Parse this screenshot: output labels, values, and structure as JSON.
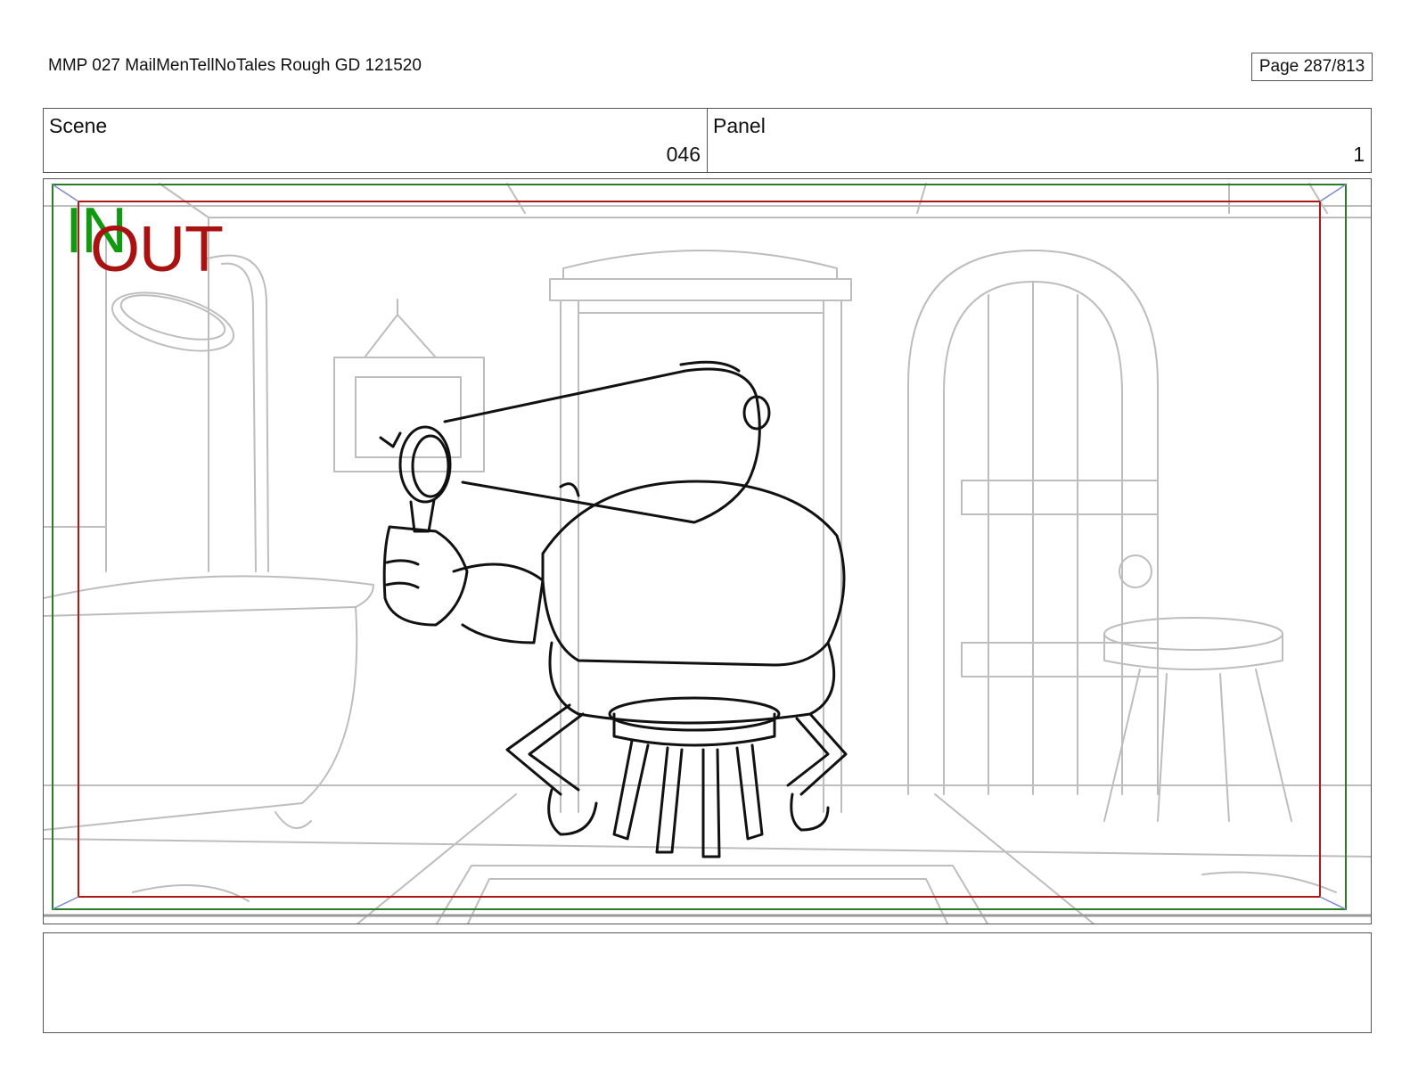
{
  "header": {
    "doc_title": "MMP 027 MailMenTellNoTales Rough GD 121520",
    "page_label": "Page 287/813"
  },
  "info": {
    "scene_label": "Scene",
    "scene_value": "046",
    "panel_label": "Panel",
    "panel_value": "1"
  },
  "panel": {
    "in_label": "IN",
    "out_label": "OUT",
    "in_color": "#119911",
    "out_color": "#aa1111"
  },
  "notes": {
    "text": ""
  }
}
